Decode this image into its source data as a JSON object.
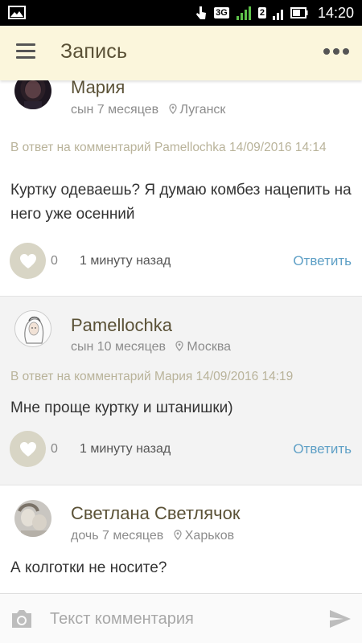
{
  "status_bar": {
    "time": "14:20",
    "network_label": "3G",
    "sim_label": "2"
  },
  "app_bar": {
    "title": "Запись"
  },
  "comments": [
    {
      "author": "Мария",
      "child": "сын 7 месяцев",
      "city": "Луганск",
      "reply_to": "В ответ на комментарий Pamellochka  14/09/2016 14:14",
      "text": "Куртку одеваешь? Я думаю комбез нацепить на него уже осенний",
      "likes": "0",
      "time": "1 минуту назад",
      "reply_label": "Ответить"
    },
    {
      "author": "Pamellochka",
      "child": "сын 10 месяцев",
      "city": "Москва",
      "reply_to": "В ответ на комментарий Мария  14/09/2016 14:19",
      "text": "Мне проще куртку и штанишки)",
      "likes": "0",
      "time": "1 минуту назад",
      "reply_label": "Ответить"
    },
    {
      "author": "Светлана Светлячок",
      "child": "дочь 7 месяцев",
      "city": "Харьков",
      "text": "А колготки не носите?"
    }
  ],
  "input": {
    "placeholder": "Текст комментария",
    "value": ""
  },
  "colors": {
    "app_bar_bg": "#fbf6dc",
    "title": "#5a5136",
    "reply_link": "#5fa0c6",
    "like_bg": "#d8d5c5",
    "reply_meta": "#b9b39a"
  },
  "icons": {
    "status_left": "image-icon",
    "signal": "signal-icon",
    "battery": "battery-icon",
    "menu": "menu-icon",
    "more": "more-icon",
    "location": "location-pin-icon",
    "like": "heart-icon",
    "camera": "camera-icon",
    "send": "send-icon"
  }
}
